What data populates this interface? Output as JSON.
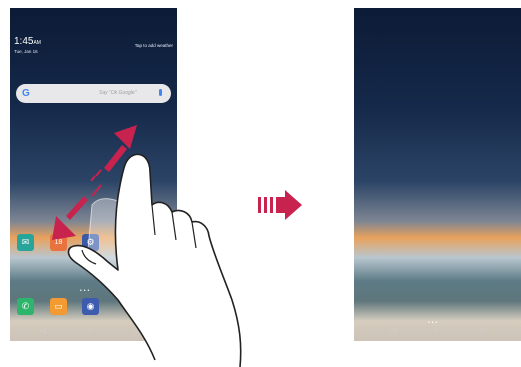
{
  "left_screen": {
    "clock": {
      "time": "1:45",
      "ampm": "AM",
      "date": "Tue, Jan 16"
    },
    "weather_prompt": "Tap to add weather",
    "search": {
      "logo": "G",
      "placeholder": "Say \"Ok Google\""
    },
    "apps_row": [
      {
        "name": "email-icon",
        "color": "#27a59b"
      },
      {
        "name": "calendar-icon",
        "label": "18",
        "color": "#e9733e"
      },
      {
        "name": "settings-icon",
        "color": "#3a5aa8"
      },
      {
        "name": "play-store-icon",
        "color": "#f3f3f3"
      }
    ],
    "dock": [
      {
        "name": "phone-icon",
        "color": "#2db56b"
      },
      {
        "name": "messages-icon",
        "color": "#f39a33"
      },
      {
        "name": "camera-icon",
        "color": "#3d5cae"
      }
    ],
    "nav": [
      "◁",
      "○",
      "□"
    ]
  },
  "right_screen": {
    "nav": [
      "◁",
      "○",
      "□"
    ]
  },
  "colors": {
    "gesture_arrow": "#c8234f",
    "transition_arrow": "#c8234f"
  }
}
